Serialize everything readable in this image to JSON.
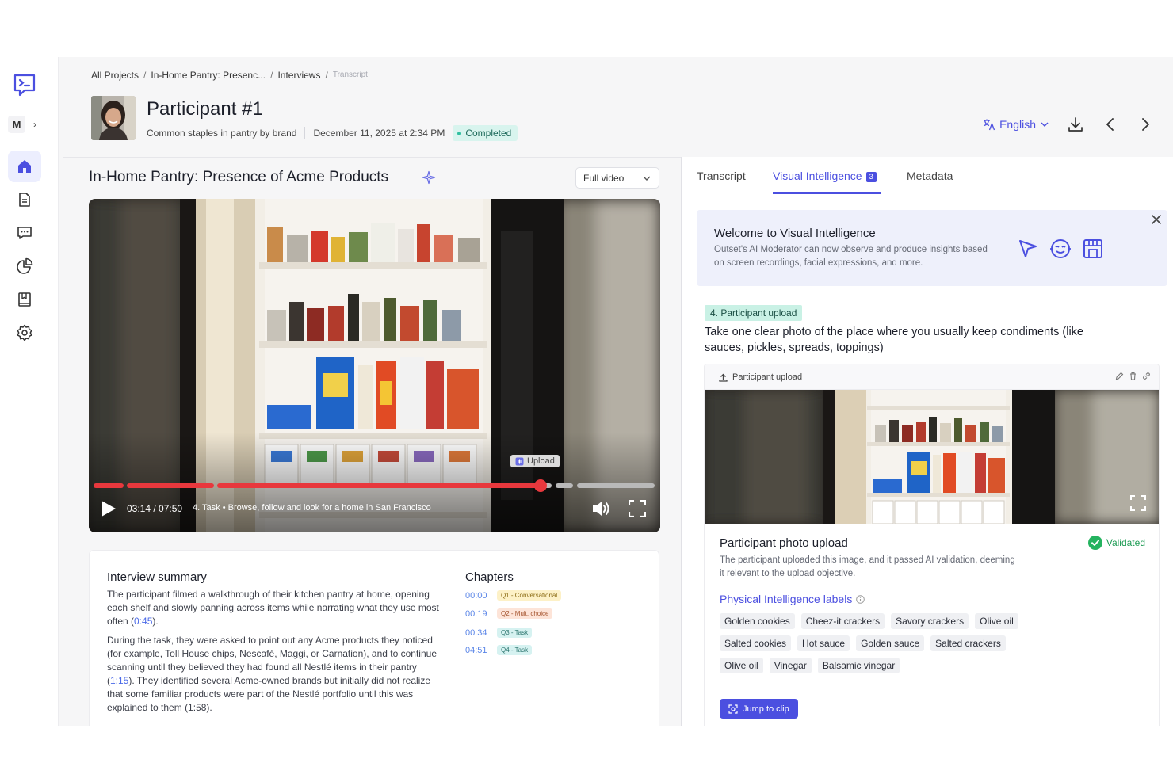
{
  "breadcrumb": {
    "items": [
      "All Projects",
      "In-Home Pantry: Presenc...",
      "Interviews",
      "Transcript"
    ],
    "separator": "/"
  },
  "sidebar": {
    "workspace_initial": "M"
  },
  "participant": {
    "name": "Participant #1",
    "study_short": "Common staples in pantry by brand",
    "date": "December 11, 2025 at 2:34 PM",
    "status": "Completed"
  },
  "header": {
    "language": "English"
  },
  "study": {
    "title": "In-Home Pantry: Presence of Acme Products",
    "view_select": "Full video"
  },
  "video": {
    "time": "03:14 / 07:50",
    "task": "4. Task • Browse, follow and look for a home in San Francisco",
    "upload_marker": "Upload",
    "progress": 0.413
  },
  "summary": {
    "title": "Interview summary",
    "p1_a": "The participant filmed a walkthrough of their kitchen pantry at home, opening each shelf and slowly panning across items while narrating what they use most often (",
    "p1_link": "0:45",
    "p1_b": ").",
    "p2_a": "During the task, they were asked to point out any Acme products they noticed (for example, Toll House chips, Nescafé, Maggi, or Carnation), and to continue scanning until they believed they had found all Nestlé items in their pantry (",
    "p2_link": "1:15",
    "p2_b": "). They identified several Acme-owned brands but initially did not realize that some familiar products were part of the Nestlé portfolio until this was explained to them (1:58)."
  },
  "chapters": {
    "title": "Chapters",
    "items": [
      {
        "time": "00:00",
        "label": "Q1 - Conversational",
        "color": "#fdf1c7",
        "text_color": "#8a6a12"
      },
      {
        "time": "00:19",
        "label": "Q2 - Mult. choice",
        "color": "#fde4d8",
        "text_color": "#a4522c"
      },
      {
        "time": "00:34",
        "label": "Q3 - Task",
        "color": "#d6f2f1",
        "text_color": "#2d7670"
      },
      {
        "time": "04:51",
        "label": "Q4 - Task",
        "color": "#d6f2f1",
        "text_color": "#2d7670"
      }
    ]
  },
  "tabs": {
    "transcript": "Transcript",
    "visual_intelligence": "Visual Intelligence",
    "visual_count": "3",
    "metadata": "Metadata"
  },
  "welcome": {
    "title": "Welcome to Visual Intelligence",
    "body": "Outset's AI Moderator can now observe and produce insights based on screen recordings, facial expressions, and more."
  },
  "task": {
    "tag": "4. Participant upload",
    "question": "Take one clear photo of the place where you usually keep condiments (like sauces, pickles, spreads, toppings)"
  },
  "upload": {
    "header": "Participant upload",
    "title": "Participant photo upload",
    "status": "Validated",
    "description": "The participant uploaded this image, and it passed AI validation, deeming it relevant to the upload objective.",
    "labels_title": "Physical Intelligence labels",
    "labels": [
      [
        "Golden cookies",
        "Cheez-it crackers",
        "Savory crackers",
        "Olive oil"
      ],
      [
        "Salted cookies",
        "Hot sauce",
        "Golden sauce",
        "Salted crackers"
      ],
      [
        "Olive oil",
        "Vinegar",
        "Balsamic vinegar"
      ]
    ],
    "jump_label": "Jump to clip"
  },
  "colors": {
    "accent": "#4b4fe0",
    "video_progress": "#e8383d",
    "completed_bg": "#d8f4ee",
    "validated": "#1f9c55"
  }
}
